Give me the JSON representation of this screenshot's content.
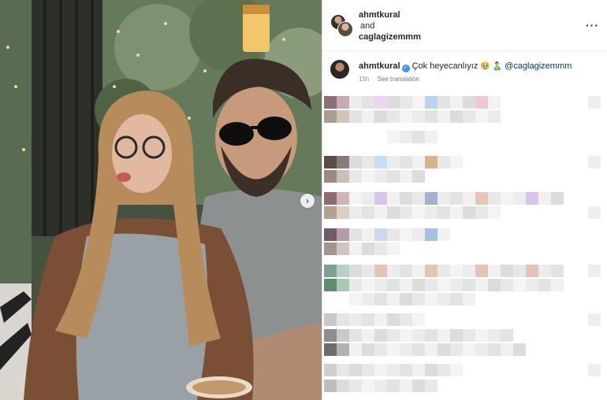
{
  "header": {
    "user1": "ahmtkural",
    "connector": "and",
    "user2": "caglagizemmm",
    "more_icon": "more-horizontal-icon"
  },
  "caption": {
    "username": "ahmtkural",
    "text": "Çok heyecanlıyız",
    "emojis": "🥹 👨‍🍼",
    "mention": "@caglagizemmm",
    "time": "15h",
    "translate": "See translation"
  },
  "photo": {
    "alt_icon": "carousel-next-icon"
  },
  "colors": {
    "verified": "#3897f0",
    "mention": "#00376b",
    "muted": "#8e8e8e"
  }
}
